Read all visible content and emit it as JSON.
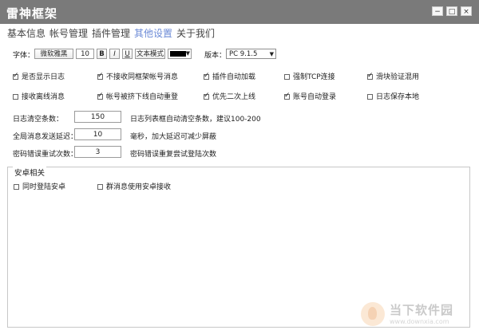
{
  "window": {
    "title": "雷神框架",
    "min": "−",
    "max": "□",
    "close": "×"
  },
  "tabs": [
    {
      "label": "基本信息"
    },
    {
      "label": "帐号管理"
    },
    {
      "label": "插件管理"
    },
    {
      "label": "其他设置"
    },
    {
      "label": "关于我们"
    }
  ],
  "font_row": {
    "label": "字体：",
    "font_name": "微软雅黑",
    "font_size": "10",
    "bold": "B",
    "italic": "I",
    "underline": "U",
    "text_mode": "文本模式",
    "color": "#000000"
  },
  "version": {
    "label": "版本：",
    "value": "PC   9.1.5"
  },
  "checkboxes_row1": [
    {
      "label": "是否显示日志",
      "checked": true
    },
    {
      "label": "不接收同框架帐号消息",
      "checked": true
    },
    {
      "label": "插件自动加载",
      "checked": true
    },
    {
      "label": "强制TCP连接",
      "checked": false
    },
    {
      "label": "滑块验证混用",
      "checked": true
    }
  ],
  "checkboxes_row2": [
    {
      "label": "接收离线消息",
      "checked": false
    },
    {
      "label": "帐号被挤下线自动重登",
      "checked": true
    },
    {
      "label": "优先二次上线",
      "checked": true
    },
    {
      "label": "账号自动登录",
      "checked": true
    },
    {
      "label": "日志保存本地",
      "checked": false
    }
  ],
  "settings": [
    {
      "label": "日志清空条数：",
      "value": "150",
      "hint": "日志列表框自动清空条数，建议100-200"
    },
    {
      "label": "全局消息发送延迟：",
      "value": "10",
      "hint": "毫秒，加大延迟可减少屏蔽"
    },
    {
      "label": "密码错误重试次数：",
      "value": "3",
      "hint": "密码错误重复尝试登陆次数"
    }
  ],
  "android": {
    "title": "安卓相关",
    "options": [
      {
        "label": "同时登陆安卓",
        "checked": false
      },
      {
        "label": "群消息使用安卓接收",
        "checked": false
      }
    ]
  },
  "watermark": {
    "name": "当下软件园",
    "url": "www.downxia.com"
  }
}
